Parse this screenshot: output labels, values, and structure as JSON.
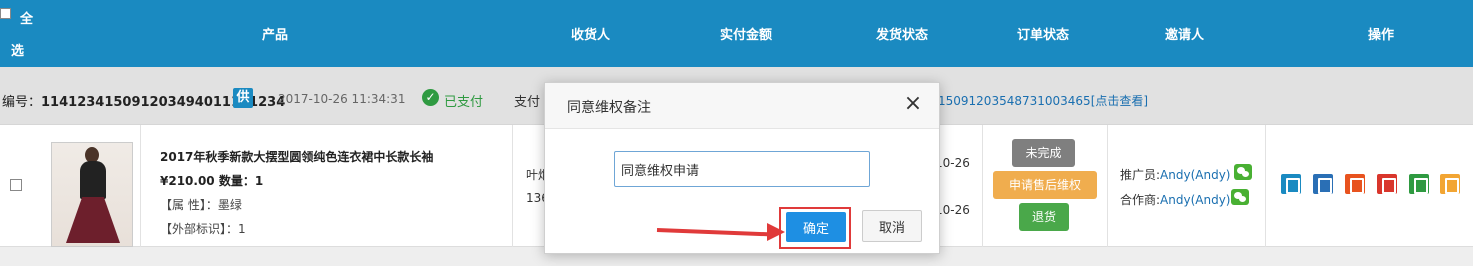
{
  "header": {
    "select_all_1": "全",
    "select_all_2": "选",
    "columns": {
      "product": "产品",
      "receiver": "收货人",
      "paid_amount": "实付金额",
      "ship_status": "发货状态",
      "order_status": "订单状态",
      "inviter": "邀请人",
      "actions": "操作"
    }
  },
  "order": {
    "no_label": "编号：",
    "no_value": "1141234150912034940111412 34",
    "no_value_exact": "114123415091203494011141234",
    "gong": "供",
    "date": "2017-10-26 11:34:31",
    "paid": "已支付",
    "pay_label": "支付",
    "link": "150912035487310034 65[点击查看]",
    "link_exact": "15091203548731003465[点击查看]"
  },
  "product": {
    "title": "2017年秋季新款大摆型圆领纯色连衣裙中长款长袖",
    "price": "¥210.00",
    "qty_label": "数量：1",
    "attr": "【属 性】：墨绿",
    "ext": "【外部标识】：1"
  },
  "receiver": {
    "name_partial": "叶𤇆",
    "phone_partial": "136"
  },
  "ship": {
    "date1": "10-26",
    "date2": "10-26"
  },
  "status": {
    "unfinished": "未完成",
    "after_sale": "申请售后维权",
    "return": "退货"
  },
  "inviter": {
    "promoter_label": "推广员:",
    "promoter_name": "Andy(Andy)",
    "partner_label": "合作商:",
    "partner_name": "Andy(Andy)"
  },
  "actions": [
    {
      "name": "note-icon",
      "color": "#1a8ac1"
    },
    {
      "name": "edit-icon",
      "color": "#2a6fb5"
    },
    {
      "name": "check-icon",
      "color": "#e8531f"
    },
    {
      "name": "refund-icon",
      "color": "#d9362c"
    },
    {
      "name": "ship-icon",
      "color": "#2f9a41"
    },
    {
      "name": "review-icon",
      "color": "#f2a533"
    }
  ],
  "modal": {
    "title": "同意维权备注",
    "close": "×",
    "input_value": "同意维权申请",
    "confirm": "确定",
    "cancel": "取消"
  }
}
